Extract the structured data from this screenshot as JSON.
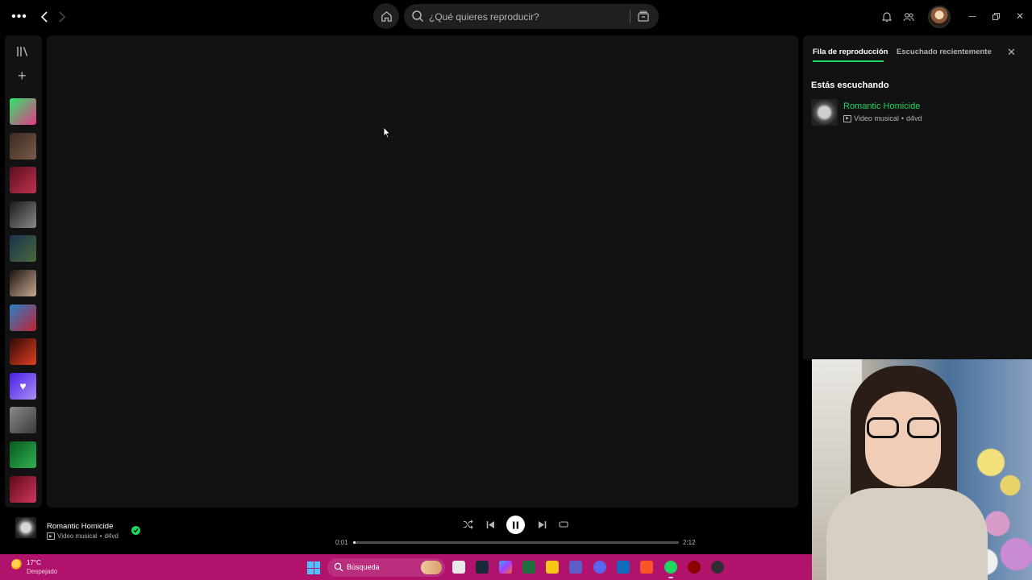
{
  "topbar": {
    "search_placeholder": "¿Qué quieres reproducir?"
  },
  "queue": {
    "tab_active": "Fila de reproducción",
    "tab_recent": "Escuchado recientemente",
    "heading": "Estás escuchando",
    "track_title": "Romantic Homicide",
    "track_type": "Video musical",
    "track_artist": "d4vd",
    "separator": "•"
  },
  "player": {
    "title": "Romantic Homicide",
    "type": "Video musical",
    "artist": "d4vd",
    "separator": "•",
    "current_time": "0:01",
    "total_time": "2:12",
    "progress_fraction": 0.008,
    "state": "playing"
  },
  "taskbar": {
    "temperature": "17°C",
    "weather": "Despejado",
    "search_label": "Búsqueda"
  },
  "colors": {
    "accent": "#1ed760",
    "taskbar": "#b0126c",
    "panel": "#121212"
  },
  "sidebar": {
    "playlists": [
      {
        "name": "playlist-wrapped-2022",
        "colors": [
          "#2ee86a",
          "#e8348a"
        ]
      },
      {
        "name": "playlist-2",
        "colors": [
          "#3a2a22",
          "#7a5a48"
        ]
      },
      {
        "name": "playlist-3",
        "colors": [
          "#5a1020",
          "#c03050"
        ]
      },
      {
        "name": "playlist-4",
        "colors": [
          "#1a1a1a",
          "#8a8a8a"
        ]
      },
      {
        "name": "playlist-5",
        "colors": [
          "#1a3050",
          "#4a6a3a"
        ]
      },
      {
        "name": "playlist-6",
        "colors": [
          "#1a1410",
          "#c8a890"
        ]
      },
      {
        "name": "playlist-7",
        "colors": [
          "#2a80c8",
          "#c02030"
        ]
      },
      {
        "name": "playlist-8",
        "colors": [
          "#300808",
          "#e04020"
        ]
      },
      {
        "name": "liked-songs",
        "colors": [
          "#4a1ee8",
          "#a890f0"
        ]
      },
      {
        "name": "playlist-10",
        "colors": [
          "#8a8a8a",
          "#3a3a3a"
        ]
      },
      {
        "name": "playlist-11",
        "colors": [
          "#0a5a20",
          "#30b050"
        ]
      },
      {
        "name": "playlist-12",
        "colors": [
          "#600818",
          "#d03860"
        ]
      }
    ]
  }
}
